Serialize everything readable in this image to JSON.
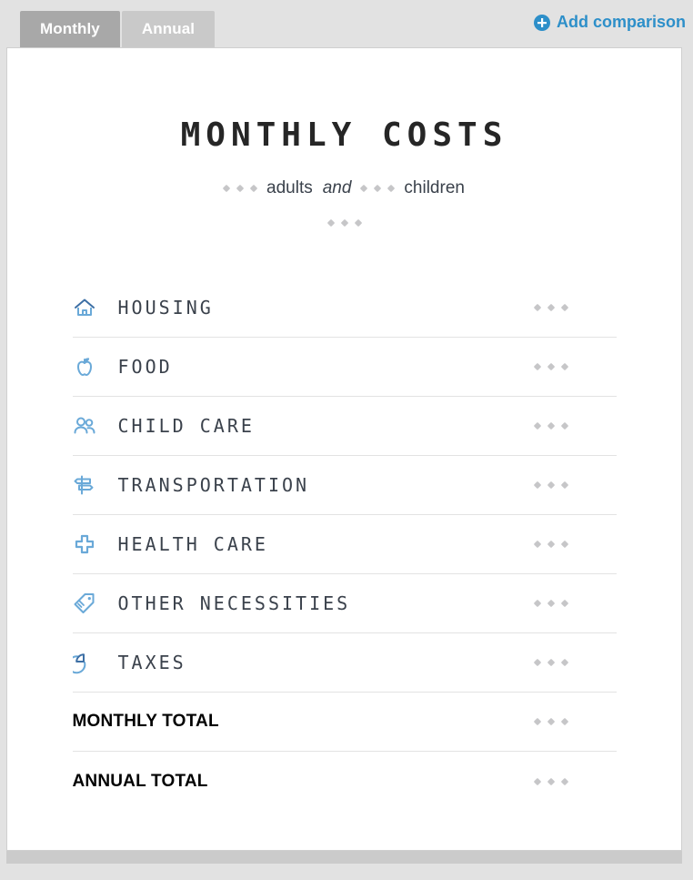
{
  "tabs": [
    {
      "label": "Monthly",
      "active": true
    },
    {
      "label": "Annual",
      "active": false
    }
  ],
  "add_comparison": {
    "label": "Add comparison",
    "icon": "plus-circle-icon",
    "color": "#2d8fc9"
  },
  "heading": {
    "title": "MONTHLY COSTS",
    "subtitle": {
      "adults_label": "adults",
      "conjunction": "and",
      "children_label": "children",
      "adults_value": "• • •",
      "children_value": "• • •",
      "location_value": "• • •"
    }
  },
  "rows": [
    {
      "label": "HOUSING",
      "icon": "house-icon",
      "value": "• • •"
    },
    {
      "label": "FOOD",
      "icon": "apple-icon",
      "value": "• • •"
    },
    {
      "label": "CHILD CARE",
      "icon": "two-people-icon",
      "value": "• • •"
    },
    {
      "label": "TRANSPORTATION",
      "icon": "signpost-icon",
      "value": "• • •"
    },
    {
      "label": "HEALTH CARE",
      "icon": "medical-cross-icon",
      "value": "• • •"
    },
    {
      "label": "OTHER NECESSITIES",
      "icon": "price-tag-icon",
      "value": "• • •"
    },
    {
      "label": "TAXES",
      "icon": "pie-chart-icon",
      "value": "• • •"
    }
  ],
  "totals": [
    {
      "label": "MONTHLY TOTAL",
      "value": "• • •"
    },
    {
      "label": "ANNUAL TOTAL",
      "value": "• • •"
    }
  ],
  "colors": {
    "accent_blue": "#2d8fc9",
    "icon_blue": "#6aa9d8",
    "icon_dark_blue": "#3d6fa5",
    "tab_active": "#a8a8a8",
    "tab_inactive": "#c9c9c9",
    "page_background": "#e2e2e2",
    "dot_gray": "#c6c6c8"
  }
}
